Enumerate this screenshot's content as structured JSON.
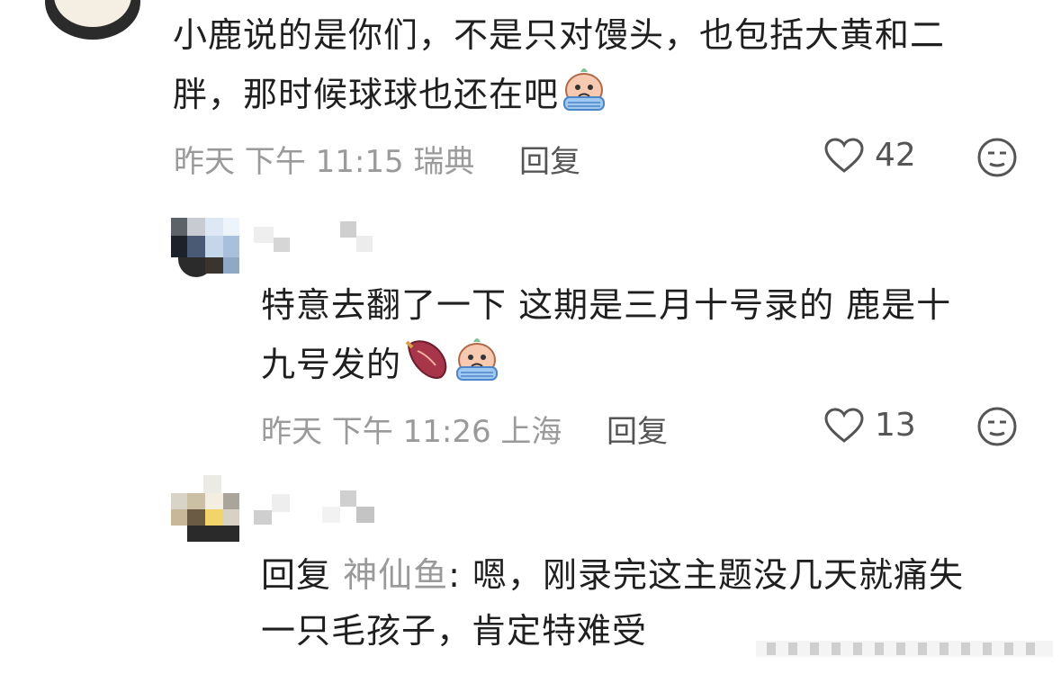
{
  "comments": [
    {
      "text_line1": "小鹿说的是你们，不是只对馒头，也包括大黄和二",
      "text_line2": "胖，那时候球球也还在吧",
      "emojis": [
        "crying-face-icon"
      ],
      "time": "昨天 下午 11:15 瑞典",
      "reply_label": "回复",
      "likes": "42"
    },
    {
      "text_line1": "特意去翻了一下 这期是三月十号录的 鹿是十",
      "text_line2": "九号发的",
      "emojis": [
        "sweet-potato-icon",
        "crying-face-icon"
      ],
      "time": "昨天 下午 11:26 上海",
      "reply_label": "回复",
      "likes": "13"
    },
    {
      "reply_prefix": "回复",
      "reply_to": "神仙鱼",
      "text_line1_rest": ": 嗯，刚录完这主题没几天就痛失",
      "text_line2": "一只毛孩子，肯定特难受"
    }
  ],
  "colors": {
    "meta": "#9a9a9a",
    "text": "#1f1f1f",
    "icon": "#555555"
  }
}
